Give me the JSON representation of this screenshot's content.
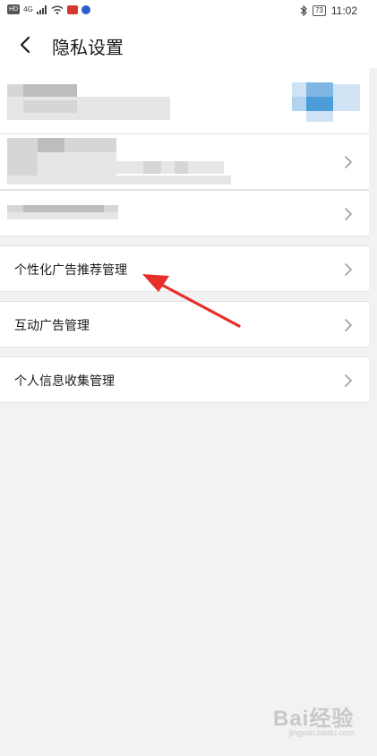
{
  "status_bar": {
    "hd": "HD",
    "network": "4G",
    "time": "11:02",
    "battery": "73"
  },
  "header": {
    "title": "隐私设置"
  },
  "rows": [
    {
      "label": "个性化广告推荐管理"
    },
    {
      "label": "互动广告管理"
    },
    {
      "label": "个人信息收集管理"
    }
  ],
  "watermark": {
    "text": "Bai经验",
    "url": "jingyan.baidu.com"
  },
  "colors": {
    "annotation_arrow": "#e8302a",
    "background": "#f2f2f2"
  }
}
